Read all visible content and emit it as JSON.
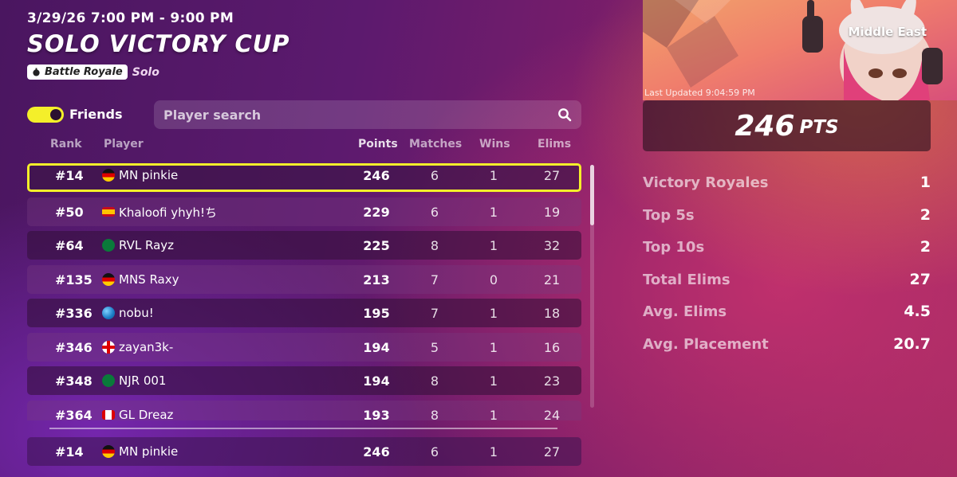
{
  "event": {
    "date": "3/29/26 7:00 PM - 9:00 PM",
    "title": "SOLO VICTORY CUP",
    "mode_label": "Battle Royale",
    "mode_sub": "Solo"
  },
  "filters": {
    "friends_label": "Friends",
    "friends_on": true,
    "search_placeholder": "Player search"
  },
  "table": {
    "headers": {
      "rank": "Rank",
      "player": "Player",
      "points": "Points",
      "matches": "Matches",
      "wins": "Wins",
      "elims": "Elims"
    },
    "rows": [
      {
        "rank": "#14",
        "flag": "flag-de",
        "player": "MN pinkie",
        "points": "246",
        "matches": "6",
        "wins": "1",
        "elims": "27"
      },
      {
        "rank": "#50",
        "flag": "flag-es",
        "player": "Khaloofi yhyh!ち",
        "points": "229",
        "matches": "6",
        "wins": "1",
        "elims": "19"
      },
      {
        "rank": "#64",
        "flag": "flag-sa",
        "player": "RVL Rayz",
        "points": "225",
        "matches": "8",
        "wins": "1",
        "elims": "32"
      },
      {
        "rank": "#135",
        "flag": "flag-de",
        "player": "MNS Raxy",
        "points": "213",
        "matches": "7",
        "wins": "0",
        "elims": "21"
      },
      {
        "rank": "#336",
        "flag": "flag-globe",
        "player": "nobu!",
        "points": "195",
        "matches": "7",
        "wins": "1",
        "elims": "18"
      },
      {
        "rank": "#346",
        "flag": "flag-en",
        "player": "zayan3k-",
        "points": "194",
        "matches": "5",
        "wins": "1",
        "elims": "16"
      },
      {
        "rank": "#348",
        "flag": "flag-sa",
        "player": "NJR 001",
        "points": "194",
        "matches": "8",
        "wins": "1",
        "elims": "23"
      },
      {
        "rank": "#364",
        "flag": "flag-ca",
        "player": "GL Dreaz",
        "points": "193",
        "matches": "8",
        "wins": "1",
        "elims": "24"
      }
    ],
    "pinned": {
      "rank": "#14",
      "flag": "flag-de",
      "player": "MN pinkie",
      "points": "246",
      "matches": "6",
      "wins": "1",
      "elims": "27"
    }
  },
  "summary": {
    "region": "Middle East",
    "last_updated": "Last Updated 9:04:59 PM",
    "points_value": "246",
    "points_unit": "PTS",
    "stats": [
      {
        "label": "Victory Royales",
        "value": "1"
      },
      {
        "label": "Top 5s",
        "value": "2"
      },
      {
        "label": "Top 10s",
        "value": "2"
      },
      {
        "label": "Total Elims",
        "value": "27"
      },
      {
        "label": "Avg. Elims",
        "value": "4.5"
      },
      {
        "label": "Avg. Placement",
        "value": "20.7"
      }
    ]
  },
  "colors": {
    "highlight": "#f4ef2a",
    "toggle_on": "#f4ef2a"
  }
}
